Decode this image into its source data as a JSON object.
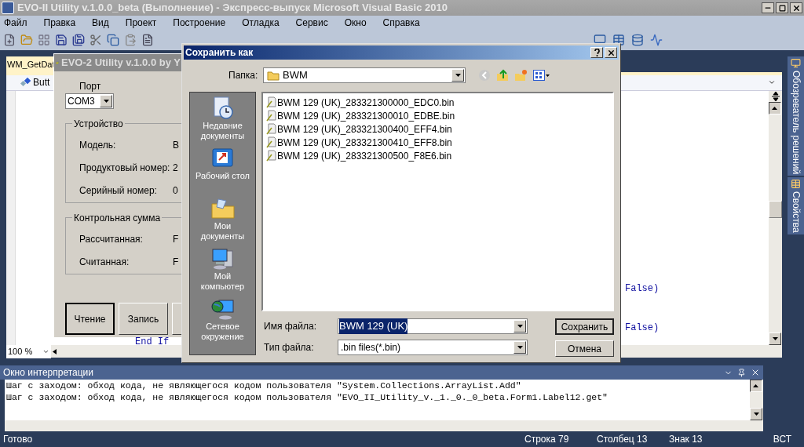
{
  "window": {
    "title": "EVO-II Utility v.1.0.0_beta (Выполнение) - Экспресс-выпуск Microsoft Visual Basic 2010"
  },
  "menu": [
    "Файл",
    "Правка",
    "Вид",
    "Проект",
    "Построение",
    "Отладка",
    "Сервис",
    "Окно",
    "Справка"
  ],
  "document_tab": {
    "label": "WM_GetDat",
    "selected": true
  },
  "editor": {
    "member_dropdown": "Butt",
    "code_lines": [
      {
        "text": "False)",
        "kind": "keyword"
      },
      {
        "text": "False)",
        "kind": "keyword"
      },
      {
        "text": "End If",
        "kind": "keyword"
      }
    ],
    "zoom": "100 %"
  },
  "side_tabs": [
    {
      "label": "Обозреватель решений",
      "kind": "solution"
    },
    {
      "label": "Свойства",
      "kind": "properties"
    }
  ],
  "app_window": {
    "title": "EVO-2 Utility v.1.0.0 by Y",
    "port_label": "Порт",
    "port": "COM3",
    "groups": [
      {
        "title": "Устройство",
        "rows": [
          {
            "label": "Модель:",
            "value": "B"
          },
          {
            "label": "Продуктовый номер:",
            "value": "2"
          },
          {
            "label": "Серийный номер:",
            "value": "0"
          }
        ]
      },
      {
        "title": "Контрольная сумма",
        "rows": [
          {
            "label": "Рассчитанная:",
            "value": "F"
          },
          {
            "label": "Считанная:",
            "value": "F"
          }
        ]
      }
    ],
    "buttons": [
      {
        "label": "Чтение",
        "default": true
      },
      {
        "label": "Запись",
        "default": false
      },
      {
        "default": false
      }
    ]
  },
  "save_dialog": {
    "title": "Сохранить как",
    "folder_label": "Папка:",
    "folder": "BWM",
    "places": [
      {
        "label": "Недавние документы",
        "kind": "recent"
      },
      {
        "label": "Рабочий стол",
        "kind": "desktop"
      },
      {
        "label": "Мои документы",
        "kind": "documents"
      },
      {
        "label": "Мой компьютер",
        "kind": "computer"
      },
      {
        "label": "Сетевое окружение",
        "kind": "network"
      }
    ],
    "files": [
      "BWM 129 (UK)_283321300000_EDC0.bin",
      "BWM 129 (UK)_283321300010_EDBE.bin",
      "BWM 129 (UK)_283321300400_EFF4.bin",
      "BWM 129 (UK)_283321300410_EFF8.bin",
      "BWM 129 (UK)_283321300500_F8E6.bin"
    ],
    "filename_label": "Имя файла:",
    "filename": "BWM 129 (UK)",
    "filename_selected": true,
    "filetype_label": "Тип файла:",
    "filetype": ".bin files(*.bin)",
    "buttons": [
      {
        "label": "Сохранить",
        "default": true
      },
      {
        "label": "Отмена",
        "default": false
      }
    ]
  },
  "immediate": {
    "title": "Окно интерпретации",
    "lines": [
      "Шаг с заходом: обход кода, не являющегося кодом пользователя \"System.Collections.ArrayList.Add\"",
      "Шаг с заходом: обход кода, не являющегося кодом пользователя \"EVO_II_Utility_v._1._0._0_beta.Form1.Label12.get\""
    ]
  },
  "status_bar": {
    "message": "Готово",
    "line": "Строка 79",
    "column": "Столбец 13",
    "char": "Знак 13",
    "mode": "ВСТ"
  }
}
